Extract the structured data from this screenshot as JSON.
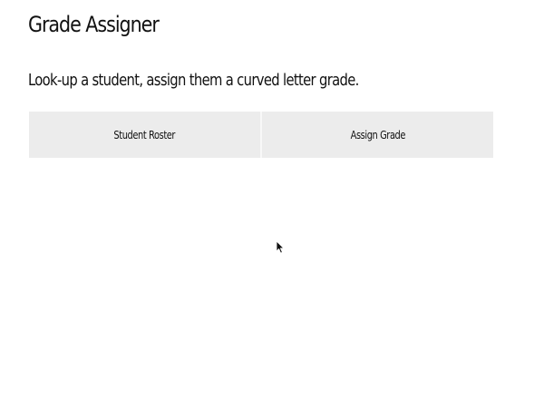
{
  "app": {
    "title": "Grade Assigner",
    "subtitle": "Look-up a student, assign them a curved letter grade."
  },
  "tabs": [
    {
      "label": "Student Roster"
    },
    {
      "label": "Assign Grade"
    }
  ],
  "colors": {
    "background": "#ffffff",
    "tab_background": "#ececec",
    "text": "#111111"
  },
  "icons": {
    "cursor": "mouse-pointer-icon"
  }
}
